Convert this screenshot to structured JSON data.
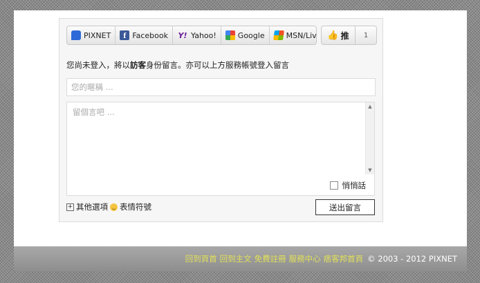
{
  "login": {
    "services": [
      {
        "label": "PIXNET",
        "icon": "pixnet-icon"
      },
      {
        "label": "Facebook",
        "icon": "facebook-icon"
      },
      {
        "label": "Yahoo!",
        "icon": "yahoo-icon"
      },
      {
        "label": "Google",
        "icon": "google-icon"
      },
      {
        "label": "MSN/Live",
        "icon": "msn-icon"
      }
    ],
    "like_label": "推",
    "like_count": "1"
  },
  "comment": {
    "guest_prefix": "您尚未登入，將以",
    "guest_bold": "訪客",
    "guest_suffix": "身份留言。亦可以上方服務帳號登入留言",
    "nickname_placeholder": "您的暱稱 ...",
    "message_placeholder": "留個言吧 ...",
    "secret_label": "悄悄話",
    "more_options": "其他選項",
    "emoticons": "表情符號",
    "submit_label": "送出留言"
  },
  "footer": {
    "links": [
      "回到頁首",
      "回到主文",
      "免費註冊",
      "服務中心",
      "痞客邦首頁"
    ],
    "copyright": "© 2003 - 2012 PIXNET"
  },
  "colors": {
    "footer_link": "#e1e05a",
    "footer_bg": "#9a9a9a"
  }
}
